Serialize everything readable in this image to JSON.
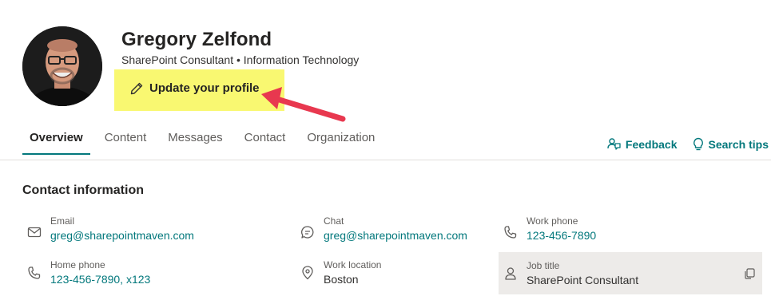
{
  "profile": {
    "name": "Gregory Zelfond",
    "subtitle": "SharePoint Consultant • Information Technology",
    "update_label": "Update your profile"
  },
  "tabs": [
    {
      "label": "Overview",
      "active": true
    },
    {
      "label": "Content",
      "active": false
    },
    {
      "label": "Messages",
      "active": false
    },
    {
      "label": "Contact",
      "active": false
    },
    {
      "label": "Organization",
      "active": false
    }
  ],
  "links": {
    "feedback": "Feedback",
    "search_tips": "Search tips"
  },
  "contact": {
    "title": "Contact information",
    "email": {
      "label": "Email",
      "value": "greg@sharepointmaven.com"
    },
    "chat": {
      "label": "Chat",
      "value": "greg@sharepointmaven.com"
    },
    "work_phone": {
      "label": "Work phone",
      "value": "123-456-7890"
    },
    "home_phone": {
      "label": "Home phone",
      "value": "123-456-7890, x123"
    },
    "work_location": {
      "label": "Work location",
      "value": "Boston"
    },
    "job_title": {
      "label": "Job title",
      "value": "SharePoint Consultant"
    }
  },
  "colors": {
    "accent": "#03787c",
    "highlight": "#f9f871",
    "arrow": "#e8384f"
  }
}
